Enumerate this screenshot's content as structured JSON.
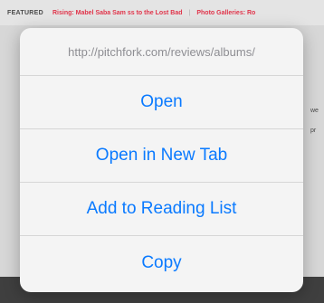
{
  "background": {
    "featured_label": "FEATURED",
    "featured_link_1": "Rising: Mabel Saba Sam  ss to the Lost Bad",
    "featured_separator": "|",
    "featured_link_2": "Photo Galleries: Ro",
    "side_text_1": "we",
    "side_text_2": "pr"
  },
  "sheet": {
    "url": "http://pitchfork.com/reviews/albums/",
    "actions": [
      {
        "label": "Open"
      },
      {
        "label": "Open in New Tab"
      },
      {
        "label": "Add to Reading List"
      },
      {
        "label": "Copy"
      }
    ]
  },
  "colors": {
    "action_text": "#0a7aff",
    "featured_link": "#e0344a"
  }
}
